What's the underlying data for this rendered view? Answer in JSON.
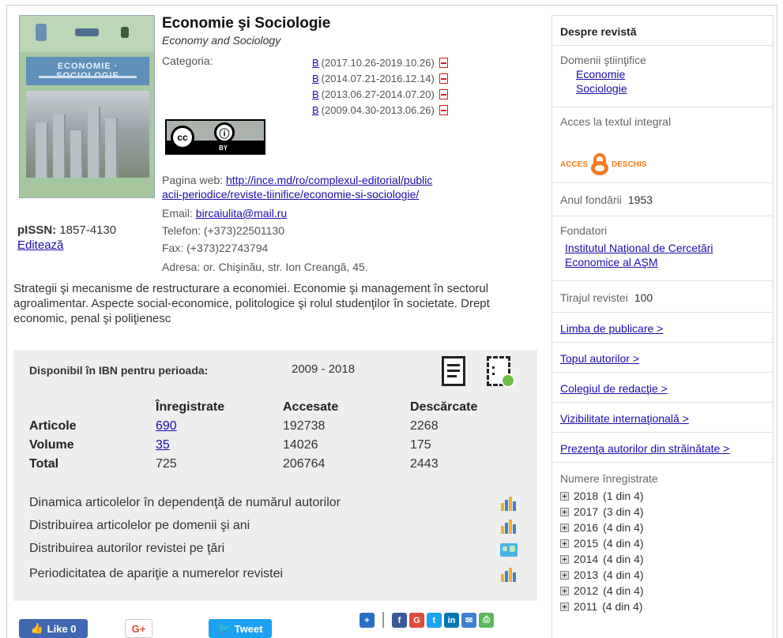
{
  "journal": {
    "title": "Economie şi Sociologie",
    "subtitle": "Economy and Sociology",
    "category_label": "Categoria:",
    "categories": [
      {
        "letter": "B",
        "period": "(2017.10.26-2019.10.26)"
      },
      {
        "letter": "B",
        "period": "(2014.07.21-2016.12.14)"
      },
      {
        "letter": "B",
        "period": "(2013.06.27-2014.07.20)"
      },
      {
        "letter": "B",
        "period": "(2009.04.30-2013.06.26)"
      }
    ],
    "pissn_label": "pISSN:",
    "pissn_value": "1857-4130",
    "edit_label": "Editează",
    "web_label": "Pagina web:",
    "web_line1": "http://ince.md/ro/complexul-editorial/public",
    "web_line2": "acii-periodice/reviste-tiinifice/economie-si-sociologie/",
    "email_label": "Email:",
    "email": "bircaiulita@mail.ru",
    "phone": "Telefon: (+373)22501130",
    "fax": "Fax: (+373)22743794",
    "address": "Adresa: or. Chişinău, str. Ion Creangă, 45.",
    "license": {
      "cc": "cc",
      "by": "BY"
    },
    "description": "Strategii şi mecanisme de restructurare a economiei. Economie şi management în sectorul agroalimentar. Aspecte social-economice, politologice şi rolul studenţilor în societate. Drept economic, penal şi poliţienesc"
  },
  "stats": {
    "available_label": "Disponibil în IBN pentru perioada:",
    "period": "2009 - 2018",
    "headers": [
      "Înregistrate",
      "Accesate",
      "Descărcate"
    ],
    "rows": [
      {
        "label": "Articole",
        "registered": "690",
        "accessed": "192738",
        "downloaded": "2268"
      },
      {
        "label": "Volume",
        "registered": "35",
        "accessed": "14026",
        "downloaded": "175"
      },
      {
        "label": "Total",
        "registered": "725",
        "accessed": "206764",
        "downloaded": "2443"
      }
    ],
    "analyses": [
      "Dinamica articolelor în dependenţă de numărul autorilor",
      "Distribuirea articolelor pe domenii şi ani",
      "Distribuirea autorilor revistei pe ţări",
      "Periodicitatea de apariţie a numerelor revistei"
    ]
  },
  "social": {
    "like_label": "Like 0",
    "gplus_label": "G+",
    "tweet_label": "Tweet",
    "share_icons": [
      "plus-icon",
      "facebook-icon",
      "google-plus-icon",
      "twitter-icon",
      "linkedin-icon",
      "email-icon",
      "print-icon"
    ]
  },
  "sidebar": {
    "about": "Despre revistă",
    "fields_label": "Domenii ştiinţifice",
    "fields": [
      "Economie",
      "Sociologie"
    ],
    "access_label": "Acces la textul integral",
    "open_access_left": "ACCES",
    "open_access_right": "DESCHIS",
    "founded_label": "Anul fondării",
    "founded_value": "1953",
    "founders_label": "Fondatori",
    "founder_line1": "Institutul Naţional de Cercetări",
    "founder_line2": "Economice al AŞM",
    "circulation_label": "Tirajul revistei",
    "circulation_value": "100",
    "links": [
      "Limba de publicare >",
      "Topul autorilor >",
      "Colegiul de redacţie >",
      "Vizibilitate internaţională >",
      "Prezenţa autorilor din străinătate >"
    ],
    "issues_label": "Numere înregistrate",
    "issues": [
      {
        "year": "2018",
        "count": "(1 din 4)"
      },
      {
        "year": "2017",
        "count": "(3 din 4)"
      },
      {
        "year": "2016",
        "count": "(4 din 4)"
      },
      {
        "year": "2015",
        "count": "(4 din 4)"
      },
      {
        "year": "2014",
        "count": "(4 din 4)"
      },
      {
        "year": "2013",
        "count": "(4 din 4)"
      },
      {
        "year": "2012",
        "count": "(4 din 4)"
      },
      {
        "year": "2011",
        "count": "(4 din 4)"
      }
    ]
  }
}
